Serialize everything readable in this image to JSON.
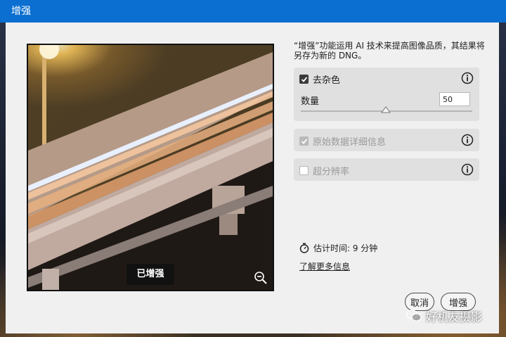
{
  "window": {
    "title": "增强"
  },
  "preview": {
    "badge": "已增强",
    "zoom_icon": "zoom-out-icon"
  },
  "description": "“增强”功能运用 AI 技术来提高图像品质，其结果将另存为新的 DNG。",
  "options": {
    "denoise": {
      "label": "去杂色",
      "checked": true,
      "enabled": true,
      "info_icon": "info-icon"
    },
    "amount": {
      "label": "数量",
      "value": "50",
      "slider_fraction": 0.5
    },
    "raw_details": {
      "label": "原始数据详细信息",
      "checked": true,
      "enabled": false,
      "info_icon": "info-icon"
    },
    "super_resolution": {
      "label": "超分辨率",
      "checked": false,
      "enabled": false,
      "info_icon": "info-icon"
    }
  },
  "estimate": {
    "icon": "stopwatch-icon",
    "text": "估计时间: 9 分钟"
  },
  "learn_more": "了解更多信息",
  "buttons": {
    "cancel": "取消",
    "enhance": "增强"
  },
  "watermark": {
    "text": "好机友摄影",
    "icon": "wechat-icon"
  },
  "colors": {
    "titlebar": "#0a6fd0",
    "dialog": "#f0f0f0",
    "panel": "#e0e0e0"
  }
}
